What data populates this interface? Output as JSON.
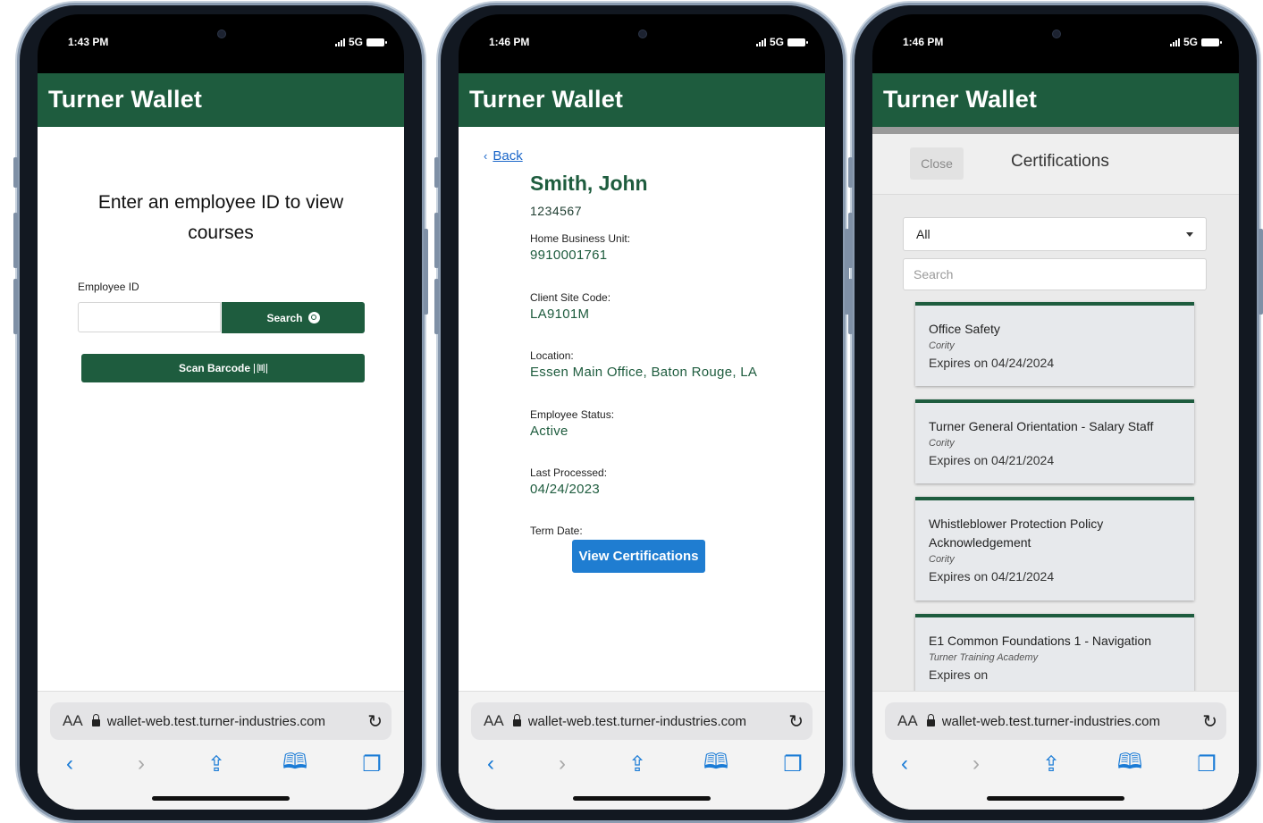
{
  "phones": [
    {
      "status": {
        "time": "1:43 PM",
        "network": "5G"
      },
      "app_title": "Turner Wallet",
      "heading": "Enter an employee ID to view courses",
      "employee_id_label": "Employee ID",
      "employee_id_value": "",
      "search_label": "Search",
      "scan_label": "Scan Barcode",
      "scan_icon": "[III]",
      "safari": {
        "aa": "AA",
        "url": "wallet-web.test.turner-industries.com"
      }
    },
    {
      "status": {
        "time": "1:46 PM",
        "network": "5G"
      },
      "app_title": "Turner Wallet",
      "back_label": "Back",
      "employee": {
        "name": "Smith, John",
        "id": "1234567",
        "home_bu_label": "Home Business Unit:",
        "home_bu": "9910001761",
        "client_site_label": "Client Site Code:",
        "client_site": "LA9101M",
        "location_label": "Location:",
        "location": "Essen Main Office, Baton Rouge, LA",
        "status_label": "Employee Status:",
        "status": "Active",
        "last_processed_label": "Last Processed:",
        "last_processed": "04/24/2023",
        "term_date_label": "Term Date:",
        "term_date": ""
      },
      "view_cert_label": "View Certifications",
      "safari": {
        "aa": "AA",
        "url": "wallet-web.test.turner-industries.com"
      }
    },
    {
      "status": {
        "time": "1:46 PM",
        "network": "5G"
      },
      "app_title": "Turner Wallet",
      "close_label": "Close",
      "panel_title": "Certifications",
      "filter_value": "All",
      "search_placeholder": "Search",
      "certs": [
        {
          "title": "Office Safety",
          "provider": "Cority",
          "expires": "Expires on 04/24/2024"
        },
        {
          "title": "Turner General Orientation - Salary Staff",
          "provider": "Cority",
          "expires": "Expires on 04/21/2024"
        },
        {
          "title": "Whistleblower Protection Policy Acknowledgement",
          "provider": "Cority",
          "expires": "Expires on 04/21/2024"
        },
        {
          "title": "E1 Common Foundations 1 - Navigation",
          "provider": "Turner Training Academy",
          "expires": "Expires on"
        }
      ],
      "safari": {
        "aa": "AA",
        "url": "wallet-web.test.turner-industries.com"
      }
    }
  ],
  "colors": {
    "brand_green": "#1e5c3e",
    "link_blue": "#1a66c9",
    "button_blue": "#1f7dd1",
    "safari_blue": "#1a7bd6"
  },
  "icons": [
    "signal-icon",
    "battery-icon",
    "search-icon",
    "barcode-icon",
    "chevron-left-icon",
    "lock-icon",
    "reload-icon",
    "back-arrow-icon",
    "forward-arrow-icon",
    "share-icon",
    "bookmarks-icon",
    "tabs-icon",
    "dropdown-caret-icon"
  ]
}
